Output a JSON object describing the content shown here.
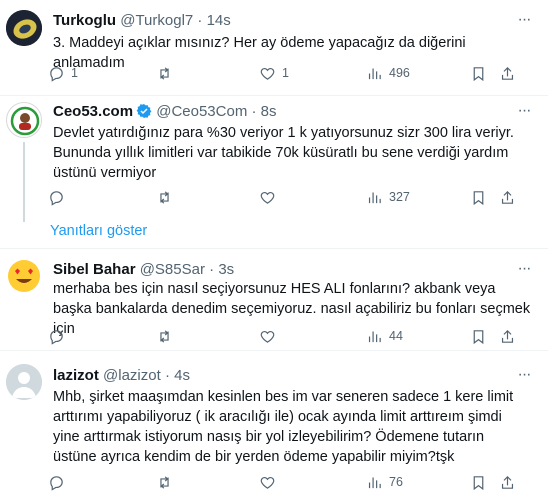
{
  "tweets": [
    {
      "name": "Turkoglu",
      "handle": "@Turkogl7",
      "time": "14s",
      "text": "3. Maddeyi açıklar mısınız? Her ay ödeme yapacağız da diğerini anlamadım",
      "replies": "1",
      "retweets": "",
      "likes": "1",
      "views": "496"
    },
    {
      "name": "Ceo53.com",
      "handle": "@Ceo53Com",
      "time": "8s",
      "verified": true,
      "text": "Devlet yatırdığınız para %30 veriyor 1 k yatıyorsunuz sizr 300 lira veriyr. Bununda yıllık limitleri var tabikide 70k küsüratlı bu sene verdiği yardım üstünü vermiyor",
      "replies": "",
      "retweets": "",
      "likes": "",
      "views": "327"
    },
    {
      "name": "Sibel Bahar",
      "handle": "@S85Sar",
      "time": "3s",
      "text": "merhaba bes için nasıl seçiyorsunuz HES ALI fonlarını? akbank veya başka bankalarda denedim seçemiyoruz. nasıl açabiliriz bu fonları seçmek için",
      "replies": "",
      "retweets": "",
      "likes": "",
      "views": "44"
    },
    {
      "name": "lazizot",
      "handle": "@lazizot",
      "time": "4s",
      "text": "Mhb,  şirket maaşımdan kesinlen bes im var seneren sadece 1 kere limit arttırımı yapabiliyoruz ( ik aracılığı ile) ocak ayında limit arttıreım şimdi yine arttırmak istiyorum nasış bir yol izleyebilirim? Ödemene tutarın üstüne ayrıca kendim de bir yerden ödeme yapabilir miyim?tşk",
      "replies": "",
      "retweets": "",
      "likes": "",
      "views": "76"
    }
  ],
  "show_replies_label": "Yanıtları göster",
  "separator": "·",
  "colors": {
    "accent": "#1d9bf0",
    "muted": "#536471",
    "divider": "#eff3f4",
    "thread_line": "#cfd9de"
  }
}
